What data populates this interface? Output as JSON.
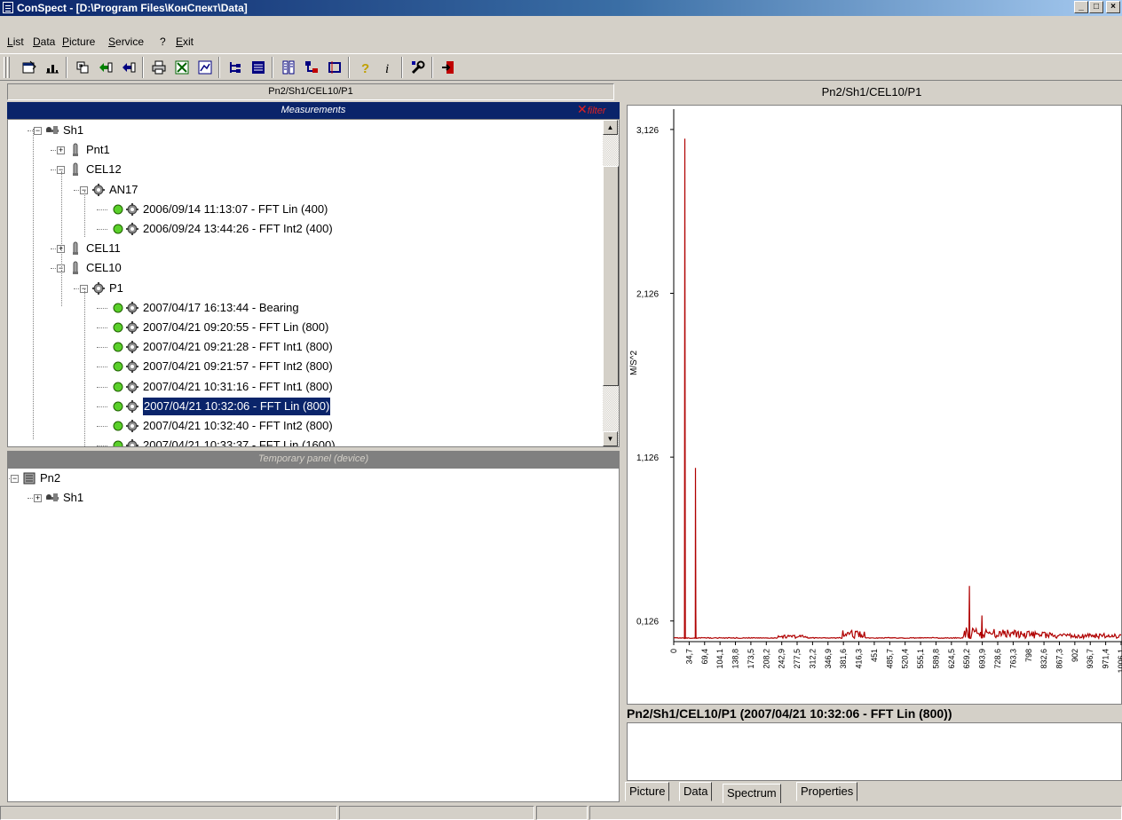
{
  "window": {
    "title": "ConSpect - [D:\\Program Files\\КонСпект\\Data]",
    "min_label": "_",
    "max_label": "□",
    "close_label": "×"
  },
  "menu": [
    "List",
    "Data",
    "Picture",
    "Service",
    "?",
    "Exit"
  ],
  "toolbar": {
    "icons": [
      "properties-icon",
      "chart-icon",
      "import-icon",
      "open-icon",
      "load-icon",
      "print-icon",
      "excel-icon",
      "export-icon",
      "tree-view-icon",
      "table-view-icon",
      "list-view-icon",
      "hierarchy-icon",
      "frame-icon",
      "help-icon",
      "info-icon",
      "settings-icon",
      "exit-icon"
    ]
  },
  "left": {
    "path": "Pn2/Sh1/CEL10/P1",
    "measurements_title": "Measurements",
    "filter_label": "filter",
    "temporary_title": "Temporary panel (device)",
    "tree": [
      {
        "label": "Sh1",
        "level": 0
      },
      {
        "label": "Pnt1",
        "level": 1
      },
      {
        "label": "CEL12",
        "level": 1
      },
      {
        "label": "AN17",
        "level": 2
      },
      {
        "label": "2006/09/14 11:13:07 - FFT Lin (400)",
        "level": 3
      },
      {
        "label": "2006/09/24 13:44:26 - FFT Int2 (400)",
        "level": 3
      },
      {
        "label": "CEL11",
        "level": 1
      },
      {
        "label": "CEL10",
        "level": 1
      },
      {
        "label": "P1",
        "level": 2
      },
      {
        "label": "2007/04/17 16:13:44 - Bearing",
        "level": 3
      },
      {
        "label": "2007/04/21 09:20:55 - FFT Lin (800)",
        "level": 3
      },
      {
        "label": "2007/04/21 09:21:28 - FFT Int1 (800)",
        "level": 3
      },
      {
        "label": "2007/04/21 09:21:57 - FFT Int2 (800)",
        "level": 3
      },
      {
        "label": "2007/04/21 10:31:16 - FFT Int1 (800)",
        "level": 3
      },
      {
        "label": "2007/04/21 10:32:06 - FFT Lin (800)",
        "level": 3,
        "selected": true
      },
      {
        "label": "2007/04/21 10:32:40 - FFT Int2 (800)",
        "level": 3
      },
      {
        "label": "2007/04/21 10:33:37 - FFT Lin (1600)",
        "level": 3
      }
    ],
    "temp_tree": [
      {
        "label": "Pn2",
        "level": 0
      },
      {
        "label": "Sh1",
        "level": 1
      }
    ]
  },
  "right": {
    "path": "Pn2/Sh1/CEL10/P1",
    "caption": "Pn2/Sh1/CEL10/P1 (2007/04/21 10:32:06 - FFT Lin (800))",
    "tabs": [
      "Picture",
      "Data",
      "Spectrum",
      "Properties"
    ],
    "active_tab": "Spectrum"
  },
  "chart_data": {
    "type": "line",
    "ylabel": "M/S^2",
    "y_ticks": [
      "3,126",
      "2,126",
      "1,126",
      "0,126"
    ],
    "y_tick_values": [
      3.126,
      2.126,
      1.126,
      0.126
    ],
    "ylim": [
      0,
      3.25
    ],
    "x_ticks": [
      "0",
      "34,7",
      "69,4",
      "104,1",
      "138,8",
      "173,5",
      "208,2",
      "242,9",
      "277,5",
      "312,2",
      "346,9",
      "381,6",
      "416,3",
      "451",
      "485,7",
      "520,4",
      "555,1",
      "589,8",
      "624,5",
      "659,2",
      "693,9",
      "728,6",
      "763,3",
      "798",
      "832,6",
      "867,3",
      "902",
      "936,7",
      "971,4",
      "1006,1"
    ],
    "x_tick_values": [
      0,
      34.7,
      69.4,
      104.1,
      138.8,
      173.5,
      208.2,
      242.9,
      277.5,
      312.2,
      346.9,
      381.6,
      416.3,
      451,
      485.7,
      520.4,
      555.1,
      589.8,
      624.5,
      659.2,
      693.9,
      728.6,
      763.3,
      798,
      832.6,
      867.3,
      902,
      936.7,
      971.4,
      1006.1
    ],
    "xlim": [
      0,
      1006.1
    ],
    "color": "#b00000",
    "peaks": [
      {
        "x": 25,
        "y": 3.07
      },
      {
        "x": 49,
        "y": 1.06
      },
      {
        "x": 49.8,
        "y": 0.17
      },
      {
        "x": 665,
        "y": 0.34
      },
      {
        "x": 693,
        "y": 0.16
      }
    ],
    "baseline": 0.02
  },
  "status": [
    "",
    "",
    "",
    ""
  ]
}
